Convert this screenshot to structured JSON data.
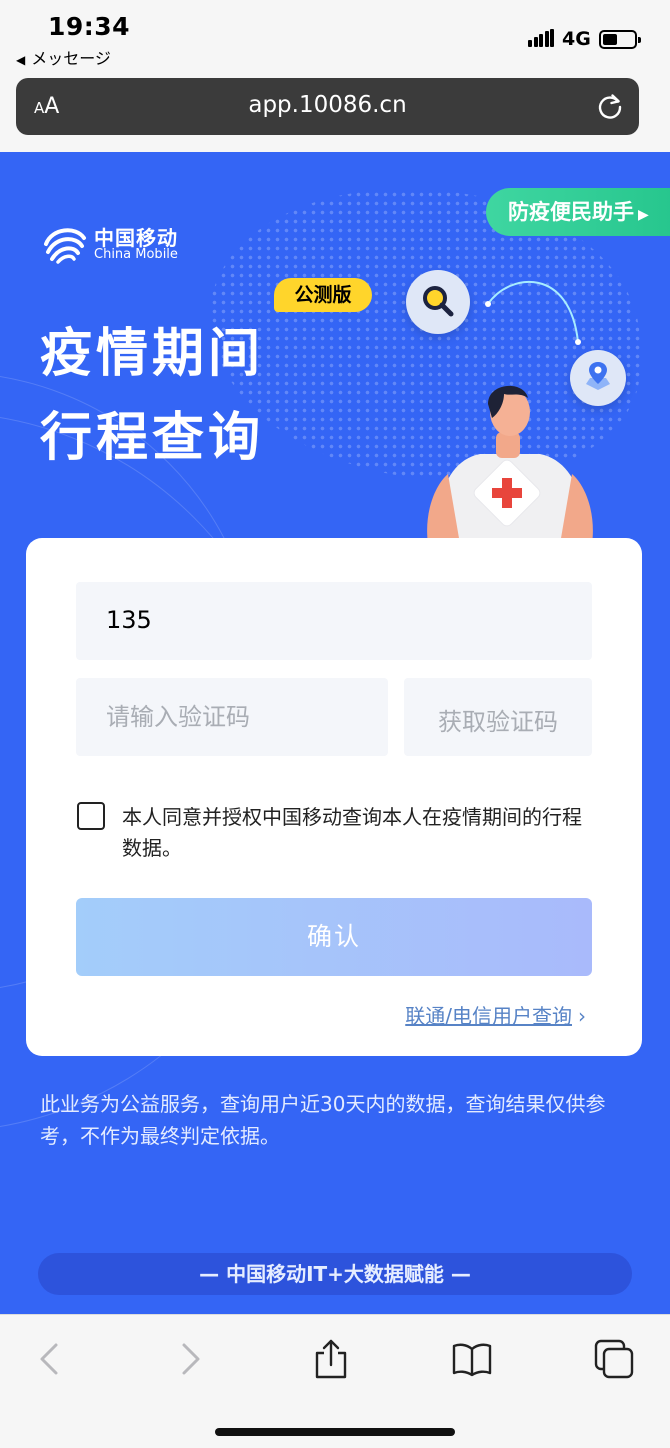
{
  "status_bar": {
    "time": "19:34",
    "back_app": "メッセージ",
    "network": "4G"
  },
  "browser": {
    "aa_label": "A",
    "aa_label_big": "A",
    "url": "app.10086.cn"
  },
  "header": {
    "logo_cn": "中国移动",
    "logo_en": "China Mobile",
    "badge": "公测版",
    "title_line1": "疫情期间",
    "title_line2": "行程查询",
    "helper_button": "防疫便民助手"
  },
  "form": {
    "phone_value": "135",
    "code_placeholder": "请输入验证码",
    "get_code_label": "获取验证码",
    "agreement_text": "本人同意并授权中国移动查询本人在疫情期间的行程数据。",
    "agreement_checked": false,
    "confirm_label": "确认",
    "other_carrier_link": "联通/电信用户查询"
  },
  "notice": "此业务为公益服务，查询用户近30天内的数据，查询结果仅供参考，不作为最终判定依据。",
  "footer": "— 中国移动IT+大数据赋能 —",
  "colors": {
    "page_bg": "#3465f5",
    "helper_green": "#3fd6a1",
    "badge_yellow": "#ffd52b",
    "link_blue": "#5783c6"
  },
  "icons": {
    "search_bubble": "search-icon",
    "location_bubble": "location-pin-icon",
    "toolbar": [
      "back-icon",
      "forward-icon",
      "share-icon",
      "bookmarks-icon",
      "tabs-icon"
    ]
  }
}
